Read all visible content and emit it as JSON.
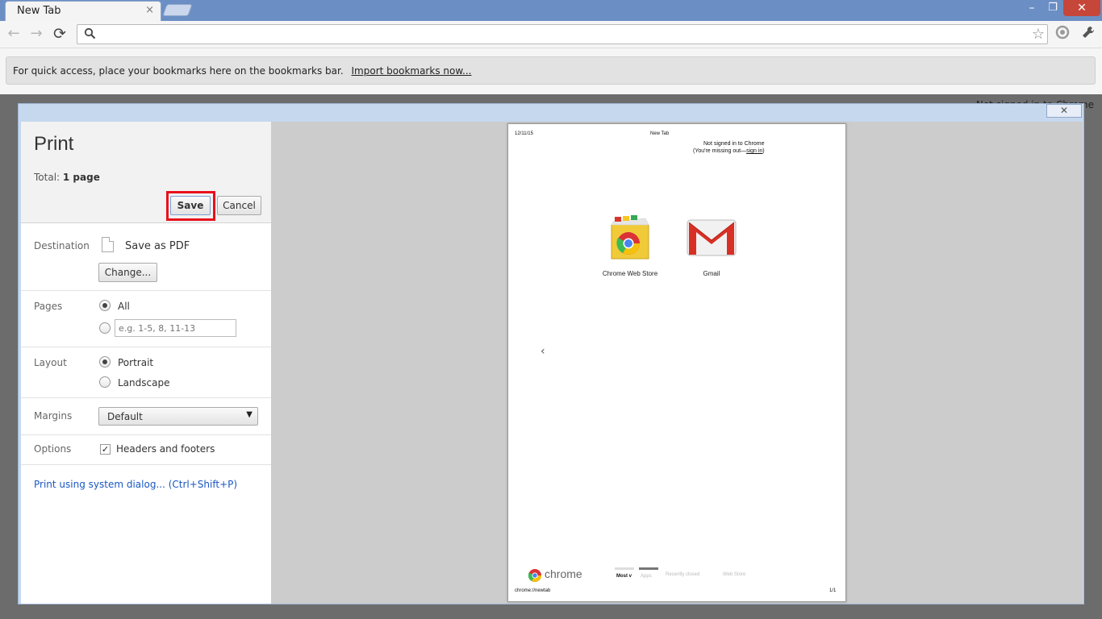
{
  "browser": {
    "tab_title": "New Tab",
    "tab_close": "×",
    "window_controls": {
      "minimize": "–",
      "maximize": "❐",
      "close": "✕"
    },
    "nav": {
      "back": "←",
      "forward": "→",
      "reload": "⟳"
    },
    "star": "☆",
    "wrench": "🔧"
  },
  "bookmarks_bar": {
    "message": "For quick access, place your bookmarks here on the bookmarks bar.",
    "import_link": "Import bookmarks now..."
  },
  "background_page": {
    "signin_text": "Not signed in to Chrome"
  },
  "print_dialog": {
    "close_glyph": "✕",
    "title": "Print",
    "total_label": "Total:",
    "total_value": "1 page",
    "save_label": "Save",
    "cancel_label": "Cancel",
    "destination": {
      "label": "Destination",
      "value": "Save as PDF",
      "change_label": "Change..."
    },
    "pages": {
      "label": "Pages",
      "all_label": "All",
      "all_selected": true,
      "range_placeholder": "e.g. 1-5, 8, 11-13"
    },
    "layout": {
      "label": "Layout",
      "portrait_label": "Portrait",
      "landscape_label": "Landscape",
      "selected": "Portrait"
    },
    "margins": {
      "label": "Margins",
      "value": "Default"
    },
    "options": {
      "label": "Options",
      "headers_footers_label": "Headers and footers",
      "headers_footers_checked": true
    },
    "system_dialog_link": "Print using system dialog... (Ctrl+Shift+P)"
  },
  "preview_page": {
    "header_date": "12/11/15",
    "header_title": "New Tab",
    "signin_line1": "Not signed in to Chrome",
    "signin_line2_prefix": "(You're missing out—",
    "signin_link": "sign in",
    "signin_line2_suffix": ")",
    "apps": [
      {
        "name": "Chrome Web Store",
        "icon": "chrome-web-store-icon"
      },
      {
        "name": "Gmail",
        "icon": "gmail-icon"
      }
    ],
    "chevron": "‹",
    "chrome_word": "chrome",
    "bottom_tabs": [
      "Most v",
      "Apps",
      "Recently closed",
      "Web Store"
    ],
    "footer_url": "chrome://newtab",
    "footer_page": "1/1"
  },
  "colors": {
    "titlebar": "#6b8fc4",
    "dialog_frame": "#c5d8ee",
    "save_highlight": "#e8111c",
    "link": "#1a57c2",
    "preview_bg": "#cccccc"
  }
}
